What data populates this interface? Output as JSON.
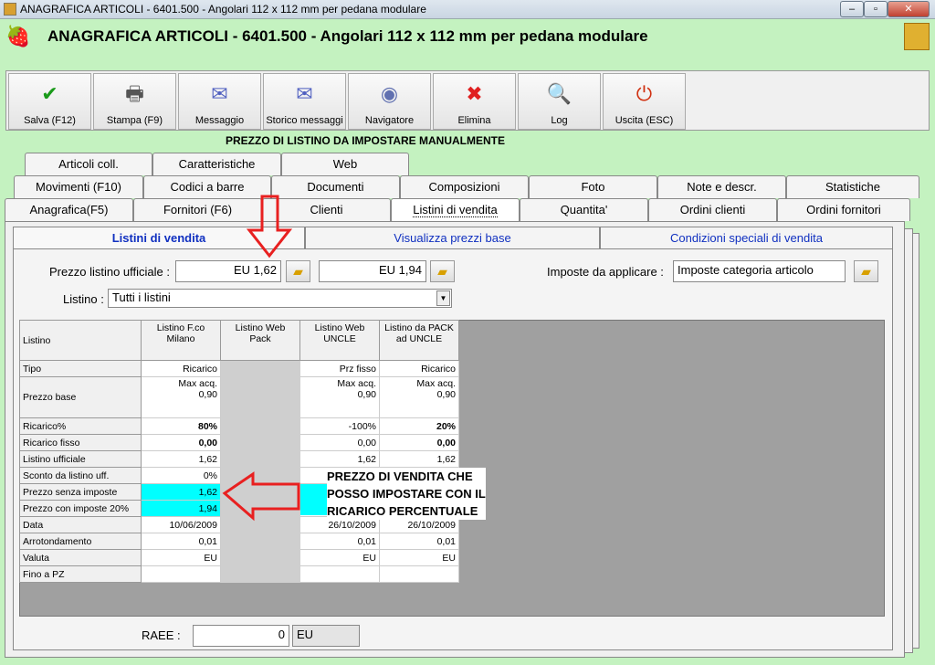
{
  "window": {
    "title": "ANAGRAFICA ARTICOLI - 6401.500 - Angolari 112 x 112 mm per pedana modulare",
    "controls": [
      "–",
      "▫",
      "✕"
    ]
  },
  "header": {
    "title": "ANAGRAFICA ARTICOLI - 6401.500 - Angolari 112 x 112 mm per pedana modulare"
  },
  "toolbar": [
    {
      "label": "Salva (F12)",
      "icon": "✔",
      "color": "#1a9a1a"
    },
    {
      "label": "Stampa (F9)",
      "icon": "🖶",
      "color": "#555"
    },
    {
      "label": "Messaggio",
      "icon": "✉",
      "color": "#5060c0"
    },
    {
      "label": "Storico messaggi",
      "icon": "✉",
      "color": "#5060c0"
    },
    {
      "label": "Navigatore",
      "icon": "◉",
      "color": "#6070b0"
    },
    {
      "label": "Elimina",
      "icon": "✖",
      "color": "#e02020"
    },
    {
      "label": "Log",
      "icon": "🔍",
      "color": "#2050c0"
    },
    {
      "label": "Uscita (ESC)",
      "icon": "⏻",
      "color": "#d03010"
    }
  ],
  "annotation_top": "PREZZO DI LISTINO DA IMPOSTARE MANUALMENTE",
  "tabs_row1": [
    "Articoli coll.",
    "Caratteristiche",
    "Web"
  ],
  "tabs_row2": [
    "Movimenti (F10)",
    "Codici a barre",
    "Documenti",
    "Composizioni",
    "Foto",
    "Note e descr.",
    "Statistiche"
  ],
  "tabs_row3": [
    "Anagrafica(F5)",
    "Fornitori (F6)",
    "Clienti",
    "Listini di vendita",
    "Quantita'",
    "Ordini clienti",
    "Ordini fornitori"
  ],
  "active_tab": "Listini di vendita",
  "subtabs": [
    "Listini di vendita",
    "Visualizza prezzi base",
    "Condizioni speciali di vendita"
  ],
  "form": {
    "prezzo_label": "Prezzo listino ufficiale :",
    "prezzo1": "EU 1,62",
    "prezzo2": "EU 1,94",
    "imposte_label": "Imposte da applicare :",
    "imposte_value": "Imposte categoria articolo",
    "listino_label": "Listino :",
    "listino_value": "Tutti i listini",
    "raee_label": "RAEE :",
    "raee_value": "0",
    "raee_unit": "EU"
  },
  "grid": {
    "headers": [
      "Listino",
      "Listino F.co Milano",
      "Listino Web Pack",
      "Listino Web UNCLE",
      "Listino da PACK ad UNCLE"
    ],
    "rows": [
      {
        "label": "Tipo",
        "cells": [
          "Ricarico",
          "",
          "Prz fisso",
          "Ricarico"
        ]
      },
      {
        "label": "Prezzo base",
        "cells": [
          "Max acq.\n0,90",
          "",
          "Max acq.\n0,90",
          "Max acq.\n0,90"
        ]
      },
      {
        "label": "Ricarico%",
        "cells": [
          "80%",
          "",
          "-100%",
          "20%"
        ]
      },
      {
        "label": "Ricarico fisso",
        "cells": [
          "0,00",
          "",
          "0,00",
          "0,00"
        ]
      },
      {
        "label": "Listino ufficiale",
        "cells": [
          "1,62",
          "",
          "1,62",
          "1,62"
        ]
      },
      {
        "label": "Sconto da listino uff.",
        "cells": [
          "0%",
          "",
          "",
          ""
        ]
      },
      {
        "label": "Prezzo senza imposte",
        "cells": [
          "1,62",
          "",
          "",
          ""
        ]
      },
      {
        "label": "Prezzo con imposte 20%",
        "cells": [
          "1,94",
          "",
          "",
          ""
        ]
      },
      {
        "label": "Data",
        "cells": [
          "10/06/2009",
          "",
          "26/10/2009",
          "26/10/2009"
        ]
      },
      {
        "label": "Arrotondamento",
        "cells": [
          "0,01",
          "",
          "0,01",
          "0,01"
        ]
      },
      {
        "label": "Valuta",
        "cells": [
          "EU",
          "",
          "EU",
          "EU"
        ]
      },
      {
        "label": "Fino a PZ",
        "cells": [
          "",
          "",
          "",
          ""
        ]
      }
    ]
  },
  "annotation_arrow": [
    "PREZZO DI VENDITA CHE",
    "POSSO IMPOSTARE CON IL",
    "RICARICO PERCENTUALE"
  ],
  "colors": {
    "background": "#c4f2c0",
    "highlight": "#00ffff",
    "arrow": "#e82020",
    "link": "#1030c0"
  }
}
